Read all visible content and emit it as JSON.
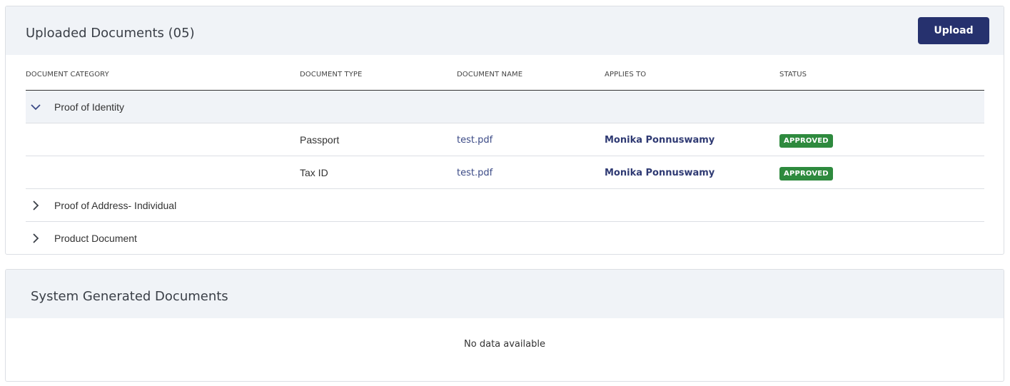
{
  "uploaded": {
    "title": "Uploaded Documents (05)",
    "upload_label": "Upload",
    "columns": [
      "DOCUMENT CATEGORY",
      "DOCUMENT TYPE",
      "DOCUMENT NAME",
      "APPLIES TO",
      "STATUS"
    ],
    "groups": [
      {
        "label": "Proof of Identity",
        "expanded": true,
        "rows": [
          {
            "type": "Passport",
            "name": "test.pdf",
            "applies_to": "Monika Ponnuswamy",
            "status": "APPROVED"
          },
          {
            "type": "Tax ID",
            "name": "test.pdf",
            "applies_to": "Monika Ponnuswamy",
            "status": "APPROVED"
          }
        ]
      },
      {
        "label": "Proof of Address- Individual",
        "expanded": false
      },
      {
        "label": "Product Document",
        "expanded": false
      }
    ]
  },
  "system": {
    "title": "System Generated Documents",
    "empty_text": "No data available"
  },
  "icons": {
    "expanded": "chevron-down-icon",
    "collapsed": "chevron-right-icon"
  },
  "colors": {
    "header_bg": "#f0f3f7",
    "primary": "#26316e",
    "approved": "#2e8a3e",
    "link": "#3b4a86"
  }
}
